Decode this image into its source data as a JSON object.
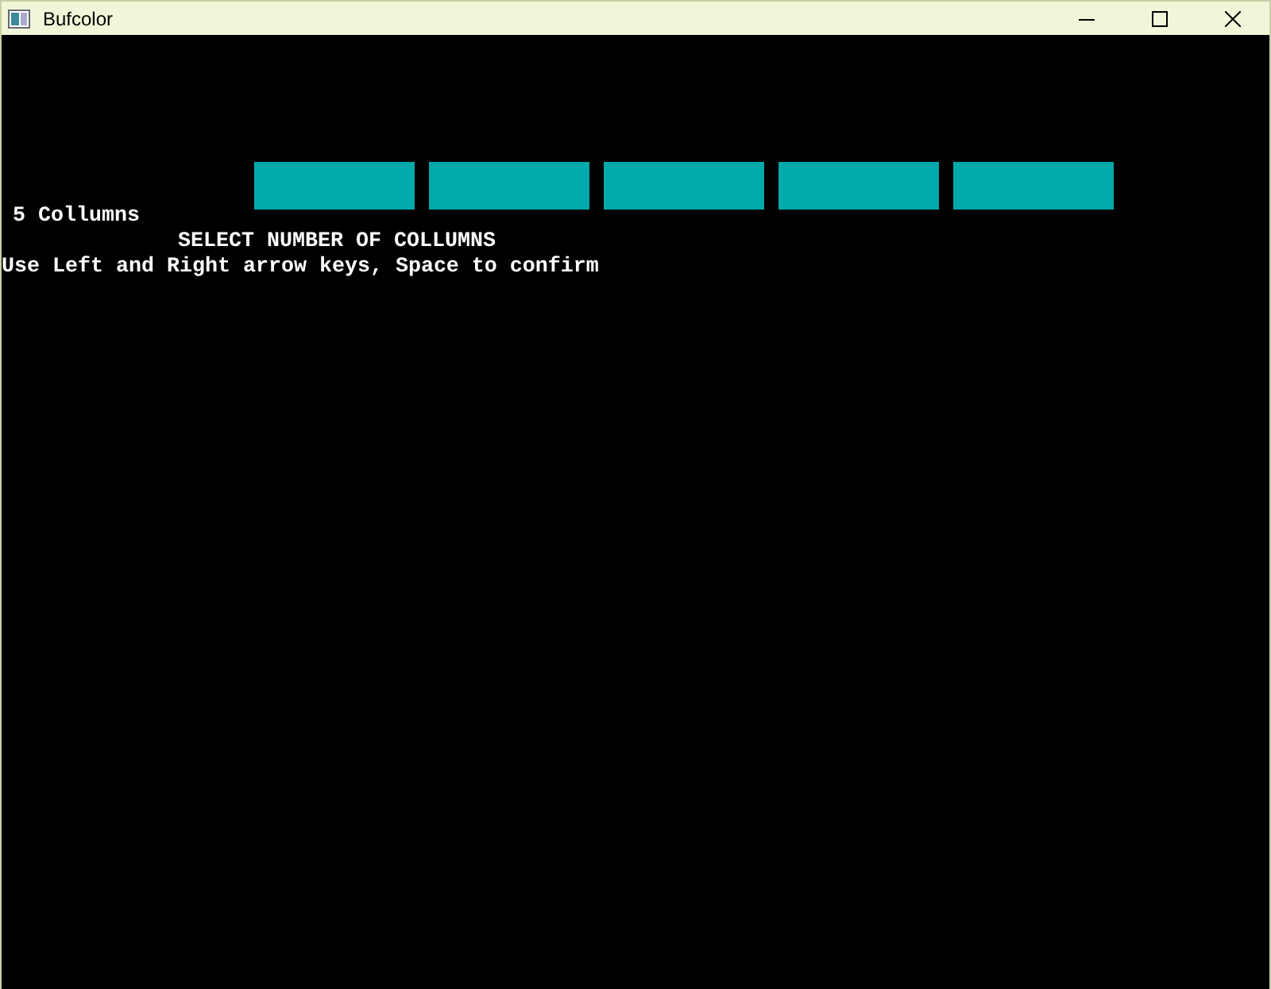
{
  "window": {
    "title": "Bufcolor"
  },
  "columns": [
    {
      "color": "#00aaaa"
    },
    {
      "color": "#00aaaa"
    },
    {
      "color": "#00aaaa"
    },
    {
      "color": "#00aaaa"
    },
    {
      "color": "#00aaaa"
    }
  ],
  "count_label": "5 Collumns",
  "heading": "SELECT NUMBER OF COLLUMNS",
  "instructions": "Use Left and Right arrow keys, Space to confirm"
}
